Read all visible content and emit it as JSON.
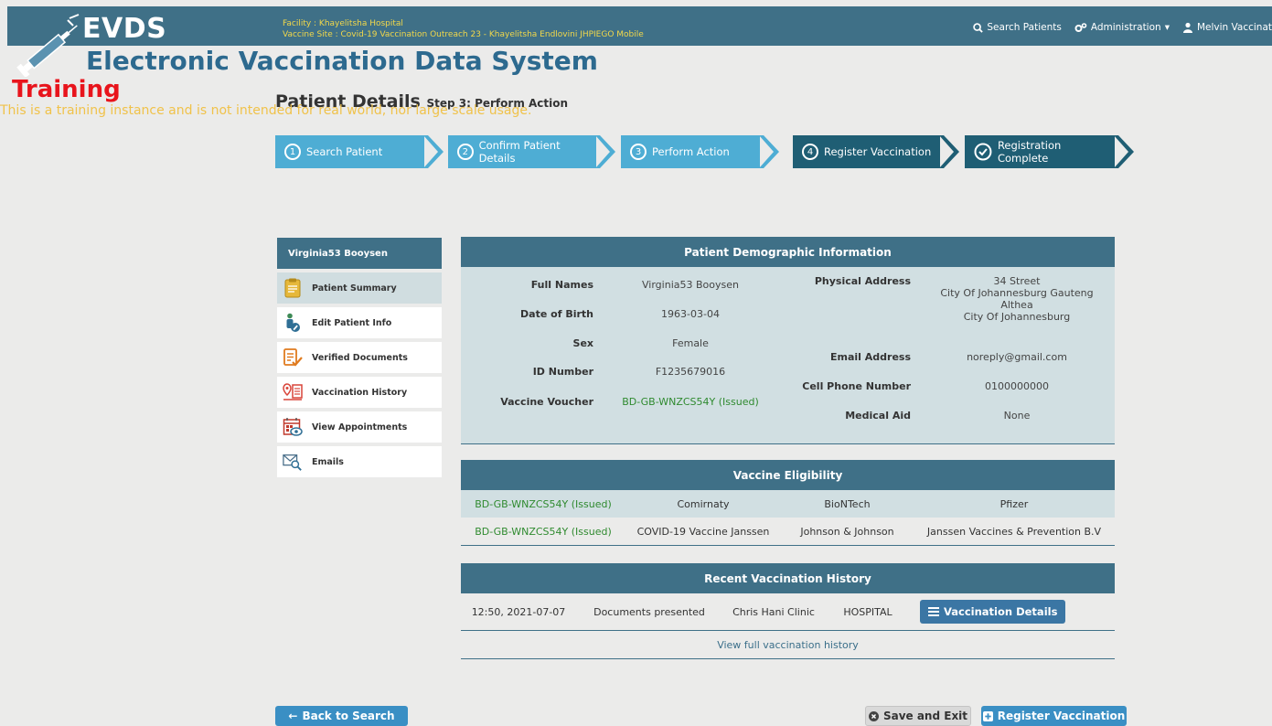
{
  "header": {
    "logo_short": "EVDS",
    "logo_full": "Electronic Vaccination Data System",
    "facility": "Facility : Khayelitsha Hospital",
    "vaccine_site": "Vaccine Site : Covid-19 Vaccination Outreach 23 - Khayelitsha Endlovini JHPIEGO Mobile",
    "nav": {
      "search_patients": "Search Patients",
      "administration": "Administration",
      "user": "Melvin Vaccinat"
    }
  },
  "training": {
    "label": "Training",
    "note": "This is a training instance and is not intended for real world, nor large scale usage."
  },
  "page": {
    "title": "Patient Details",
    "subtitle": "Step 3: Perform Action"
  },
  "steps": [
    {
      "num": "1",
      "label": "Search Patient"
    },
    {
      "num": "2",
      "label": "Confirm Patient Details"
    },
    {
      "num": "3",
      "label": "Perform Action"
    },
    {
      "num": "4",
      "label": "Register Vaccination"
    },
    {
      "label": "Registration Complete"
    }
  ],
  "sidebar": {
    "patient_name": "Virginia53 Booysen",
    "items": [
      {
        "label": "Patient Summary",
        "icon": "clipboard-icon"
      },
      {
        "label": "Edit Patient Info",
        "icon": "person-edit-icon"
      },
      {
        "label": "Verified Documents",
        "icon": "document-check-icon"
      },
      {
        "label": "Vaccination History",
        "icon": "map-list-icon"
      },
      {
        "label": "View Appointments",
        "icon": "calendar-eye-icon"
      },
      {
        "label": "Emails",
        "icon": "envelope-search-icon"
      }
    ]
  },
  "demographics": {
    "title": "Patient Demographic Information",
    "full_names_label": "Full Names",
    "full_names": "Virginia53 Booysen",
    "dob_label": "Date of Birth",
    "dob": "1963-03-04",
    "sex_label": "Sex",
    "sex": "Female",
    "id_label": "ID Number",
    "id": "F1235679016",
    "voucher_label": "Vaccine Voucher",
    "voucher": "BD-GB-WNZCS54Y (Issued)",
    "address_label": "Physical Address",
    "address_line1": "34 Street",
    "address_line2": "City Of Johannesburg Gauteng",
    "address_line3": "Althea",
    "address_line4": "City Of Johannesburg",
    "email_label": "Email Address",
    "email": "noreply@gmail.com",
    "cell_label": "Cell Phone Number",
    "cell": "0100000000",
    "medical_aid_label": "Medical Aid",
    "medical_aid": "None"
  },
  "eligibility": {
    "title": "Vaccine Eligibility",
    "rows": [
      {
        "voucher": "BD-GB-WNZCS54Y (Issued)",
        "vaccine": "Comirnaty",
        "brand": "BioNTech",
        "manufacturer": "Pfizer"
      },
      {
        "voucher": "BD-GB-WNZCS54Y (Issued)",
        "vaccine": "COVID-19 Vaccine Janssen",
        "brand": "Johnson & Johnson",
        "manufacturer": "Janssen Vaccines & Prevention B.V"
      }
    ]
  },
  "history": {
    "title": "Recent Vaccination History",
    "row": {
      "time": "12:50, 2021-07-07",
      "documents": "Documents presented",
      "site": "Chris Hani Clinic",
      "type": "HOSPITAL"
    },
    "details_button": "Vaccination Details",
    "view_full": "View full vaccination history"
  },
  "actions": {
    "back": "Back to Search",
    "save_exit": "Save and Exit",
    "register": "Register Vaccination"
  },
  "colors": {
    "header_bg": "#3f7087",
    "step_done": "#4eadd4",
    "step_todo": "#1f5e74",
    "training": "#e8141c",
    "voucher_green": "#2f8a2f"
  }
}
